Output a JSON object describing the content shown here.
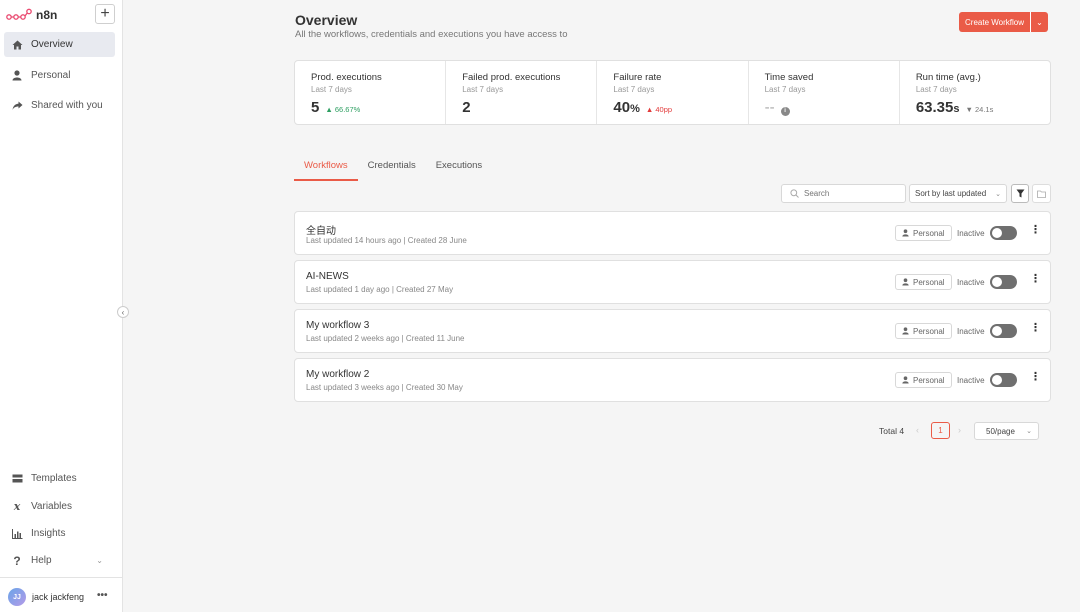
{
  "app": {
    "brand": "n8n",
    "add_symbol": "+"
  },
  "sidebar": {
    "items": [
      {
        "label": "Overview",
        "icon": "home-icon",
        "active": true
      },
      {
        "label": "Personal",
        "icon": "user-icon"
      },
      {
        "label": "Shared with you",
        "icon": "share-icon"
      }
    ],
    "bottom_items": [
      {
        "label": "Templates",
        "icon": "templates-icon"
      },
      {
        "label": "Variables",
        "icon": "variables-icon"
      },
      {
        "label": "Insights",
        "icon": "insights-icon"
      },
      {
        "label": "Help",
        "icon": "help-icon"
      }
    ],
    "user": {
      "initials": "JJ",
      "name": "jack jackfeng",
      "more": "•••"
    }
  },
  "header": {
    "title": "Overview",
    "subtitle": "All the workflows, credentials and executions you have access to",
    "create_label": "Create Workflow"
  },
  "stats": [
    {
      "title": "Prod. executions",
      "sub": "Last 7 days",
      "value": "5",
      "unit": "",
      "delta": "▲ 66.67%",
      "delta_kind": "up"
    },
    {
      "title": "Failed prod. executions",
      "sub": "Last 7 days",
      "value": "2",
      "unit": "",
      "delta": "",
      "delta_kind": ""
    },
    {
      "title": "Failure rate",
      "sub": "Last 7 days",
      "value": "40",
      "unit": "%",
      "delta": "▲ 40pp",
      "delta_kind": "red"
    },
    {
      "title": "Time saved",
      "sub": "Last 7 days",
      "value": "--",
      "unit": "",
      "delta": "i",
      "delta_kind": "info"
    },
    {
      "title": "Run time (avg.)",
      "sub": "Last 7 days",
      "value": "63.35",
      "unit": "s",
      "delta": "▼ 24.1s",
      "delta_kind": "grey"
    }
  ],
  "tabs": [
    {
      "label": "Workflows",
      "active": true
    },
    {
      "label": "Credentials"
    },
    {
      "label": "Executions"
    }
  ],
  "toolbar": {
    "search_placeholder": "Search",
    "sort_label": "Sort by last updated"
  },
  "workflows": [
    {
      "name": "全自动",
      "meta": "Last updated 14 hours ago | Created 28 June",
      "owner": "Personal",
      "status": "Inactive"
    },
    {
      "name": "AI-NEWS",
      "meta": "Last updated 1 day ago | Created 27 May",
      "owner": "Personal",
      "status": "Inactive"
    },
    {
      "name": "My workflow 3",
      "meta": "Last updated 2 weeks ago | Created 11 June",
      "owner": "Personal",
      "status": "Inactive"
    },
    {
      "name": "My workflow 2",
      "meta": "Last updated 3 weeks ago | Created 30 May",
      "owner": "Personal",
      "status": "Inactive"
    }
  ],
  "pagination": {
    "total": "Total 4",
    "current": "1",
    "per_page": "50/page"
  },
  "colors": {
    "accent": "#ea5b47",
    "positive": "#2e9f62",
    "negative": "#e23b3b"
  }
}
